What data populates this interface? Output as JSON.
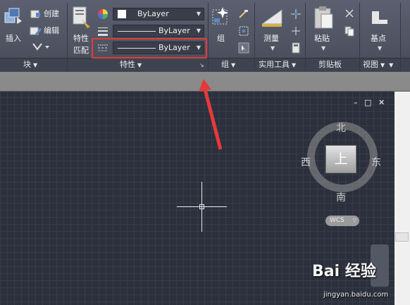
{
  "ribbon": {
    "block_panel": {
      "insert_label": "插入",
      "create_label": "创建",
      "edit_label": "编辑",
      "title": "块"
    },
    "properties_panel": {
      "match_label_line1": "特性",
      "match_label_line2": "匹配",
      "color_value": "ByLayer",
      "lineweight_value": "ByLayer",
      "linetype_value": "ByLayer",
      "title": "特性"
    },
    "groups_panel": {
      "group_label": "组",
      "title": "组"
    },
    "utilities_panel": {
      "measure_label": "测量",
      "title": "实用工具"
    },
    "clipboard_panel": {
      "paste_label": "粘贴",
      "title": "剪贴板"
    },
    "view_panel": {
      "basepoint_label": "基点",
      "title": "视图"
    }
  },
  "viewcube": {
    "north": "北",
    "south": "南",
    "east": "东",
    "west": "西",
    "face": "上",
    "wcs": "WCS"
  },
  "window_controls": {
    "minimize": "–",
    "restore": "□",
    "close": "✕"
  },
  "watermark": {
    "brand": "Bai 经验",
    "url": "jingyan.baidu.com"
  },
  "colors": {
    "highlight": "#e33a3a",
    "ribbon": "#50556a",
    "canvas": "#2b303c"
  }
}
